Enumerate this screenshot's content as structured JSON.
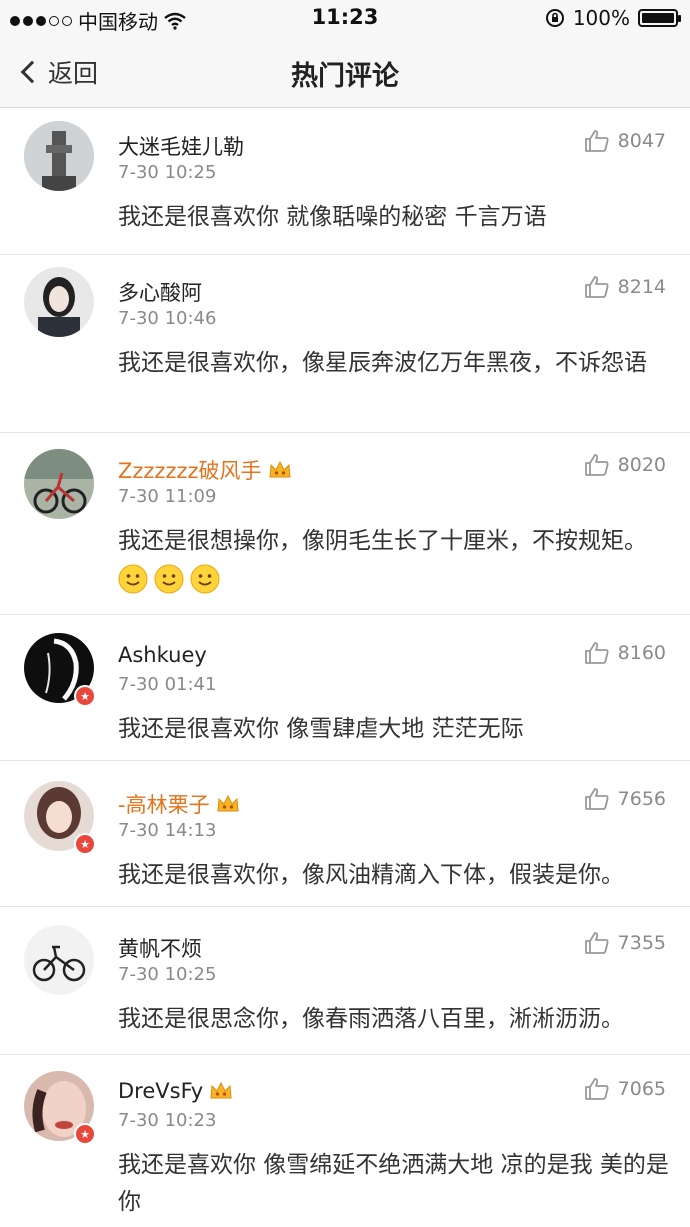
{
  "status": {
    "carrier": "中国移动",
    "time": "11:23",
    "battery": "100%"
  },
  "nav": {
    "back_label": "返回",
    "title": "热门评论"
  },
  "comments": [
    {
      "name": "大迷毛娃儿勒",
      "time": "7-30 10:25",
      "likes": "8047",
      "text": "我还是很喜欢你 就像聒噪的秘密 千言万语",
      "vip": false,
      "verified": false,
      "avatar_color": "#7c7c7c"
    },
    {
      "name": "多心酸阿",
      "time": "7-30 10:46",
      "likes": "8214",
      "text": "我还是很喜欢你，像星辰奔波亿万年黑夜，不诉怨语",
      "vip": false,
      "verified": false,
      "avatar_color": "#3a3f4a"
    },
    {
      "name": "Zzzzzzz破风手",
      "time": "7-30 11:09",
      "likes": "8020",
      "text": "我还是很想操你，像阴毛生长了十厘米，不按规矩。",
      "vip": true,
      "verified": false,
      "avatar_color": "#6b7a6a"
    },
    {
      "name": "Ashkuey",
      "time": "7-30 01:41",
      "likes": "8160",
      "text": "我还是很喜欢你 像雪肆虐大地 茫茫无际",
      "vip": false,
      "verified": true,
      "avatar_color": "#111111"
    },
    {
      "name": "-高林栗子",
      "time": "7-30 14:13",
      "likes": "7656",
      "text": "我还是很喜欢你，像风油精滴入下体，假装是你。",
      "vip": true,
      "verified": true,
      "avatar_color": "#c9a79a"
    },
    {
      "name": "黄帆不烦",
      "time": "7-30 10:25",
      "likes": "7355",
      "text": "我还是很思念你，像春雨洒落八百里，淅淅沥沥。",
      "vip": false,
      "verified": false,
      "avatar_color": "#eeeeee"
    },
    {
      "name": "DreVsFy",
      "time": "7-30 10:23",
      "likes": "7065",
      "text": "我还是喜欢你 像雪绵延不绝洒满大地 凉的是我 美的是你",
      "vip": true,
      "verified": true,
      "avatar_color": "#b88a82"
    }
  ]
}
